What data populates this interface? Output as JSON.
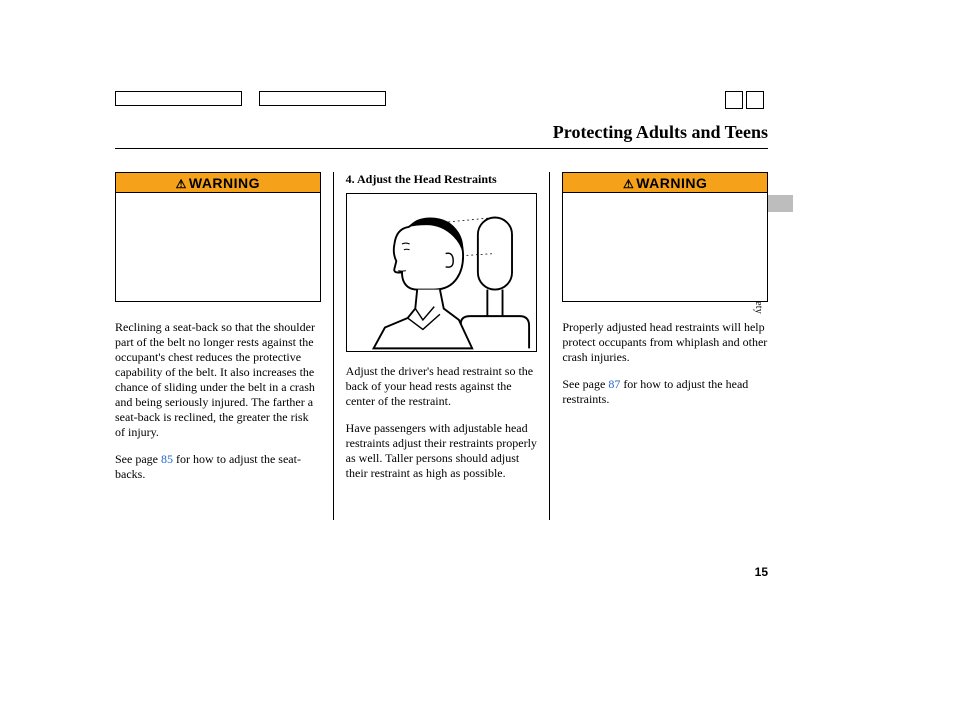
{
  "title": "Protecting Adults and Teens",
  "side_text": "Driver and Passenger Safety",
  "page_number": "15",
  "warning_label": "WARNING",
  "col1": {
    "p1": "Reclining a seat-back so that the shoulder part of the belt no longer rests against the occupant's chest reduces the protective capability of the belt. It also increases the chance of sliding under the belt in a crash and being seriously injured. The farther a seat-back is reclined, the greater the risk of injury.",
    "p2_a": "See page ",
    "p2_num": "85",
    "p2_b": " for how to adjust the seat-backs."
  },
  "col2": {
    "heading": "4. Adjust the Head Restraints",
    "p1": "Adjust the driver's head restraint so the back of your head rests against the center of the restraint.",
    "p2": "Have passengers with adjustable head restraints adjust their restraints properly as well. Taller persons should adjust their restraint as high as possible."
  },
  "col3": {
    "p1": "Properly adjusted head restraints will help protect occupants from whiplash and other crash injuries.",
    "p2_a": "See page ",
    "p2_num": "87",
    "p2_b": " for how to adjust the head restraints."
  }
}
